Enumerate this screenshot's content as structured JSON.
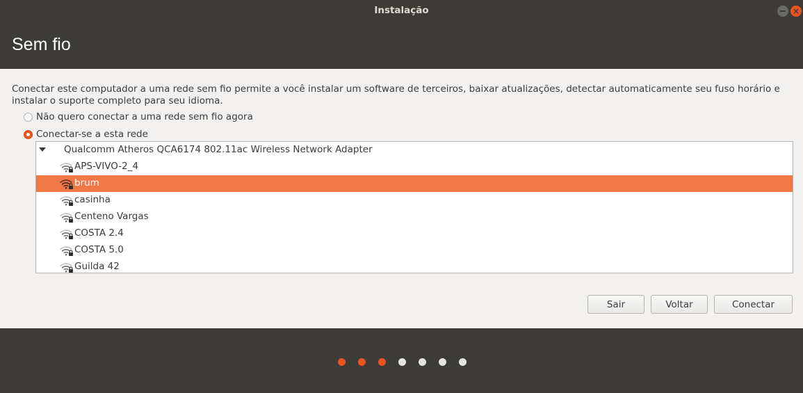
{
  "window": {
    "title": "Instalação",
    "close_glyph": "×"
  },
  "page": {
    "title": "Sem fio",
    "description": "Conectar este computador a uma rede sem fio permite a você instalar um software de terceiros, baixar atualizações, detectar automaticamente seu fuso horário e instalar o suporte completo para seu idioma."
  },
  "options": [
    {
      "label": "Não quero conectar a uma rede sem fio agora",
      "checked": false
    },
    {
      "label": "Conectar-se a esta rede",
      "checked": true
    }
  ],
  "adapter": {
    "name": "Qualcomm Atheros QCA6174 802.11ac Wireless Network Adapter",
    "expanded": true
  },
  "networks": [
    {
      "name": "APS-VIVO-2_4",
      "secured": true,
      "selected": false
    },
    {
      "name": "brum",
      "secured": true,
      "selected": true
    },
    {
      "name": "casinha",
      "secured": true,
      "selected": false
    },
    {
      "name": "Centeno Vargas",
      "secured": true,
      "selected": false
    },
    {
      "name": "COSTA 2.4",
      "secured": true,
      "selected": false
    },
    {
      "name": "COSTA 5.0",
      "secured": true,
      "selected": false
    },
    {
      "name": "Guilda 42",
      "secured": true,
      "selected": false
    }
  ],
  "buttons": {
    "quit": "Sair",
    "back": "Voltar",
    "connect": "Conectar"
  },
  "progress": {
    "total_steps": 7,
    "completed_steps": 3
  },
  "colors": {
    "accent": "#e95420",
    "selection": "#f07746",
    "chrome": "#3c3b37",
    "content_bg": "#f2f1f0"
  },
  "icons": {
    "network": "wifi-lock-icon",
    "expander": "triangle-down-icon"
  }
}
